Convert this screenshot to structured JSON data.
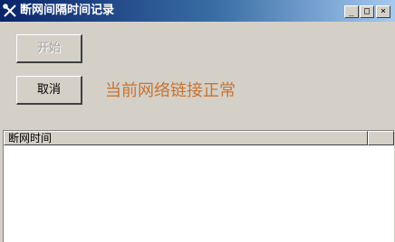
{
  "window": {
    "title": "断网间隔时间记录",
    "icon": "tools-icon",
    "controls": {
      "minimize": "_",
      "maximize": "□",
      "close": "×"
    }
  },
  "buttons": {
    "start_label": "开始",
    "cancel_label": "取消"
  },
  "status": {
    "text": "当前网络链接正常",
    "color": "#c87332"
  },
  "list": {
    "columns": [
      "断网时间",
      ""
    ],
    "rows": []
  }
}
